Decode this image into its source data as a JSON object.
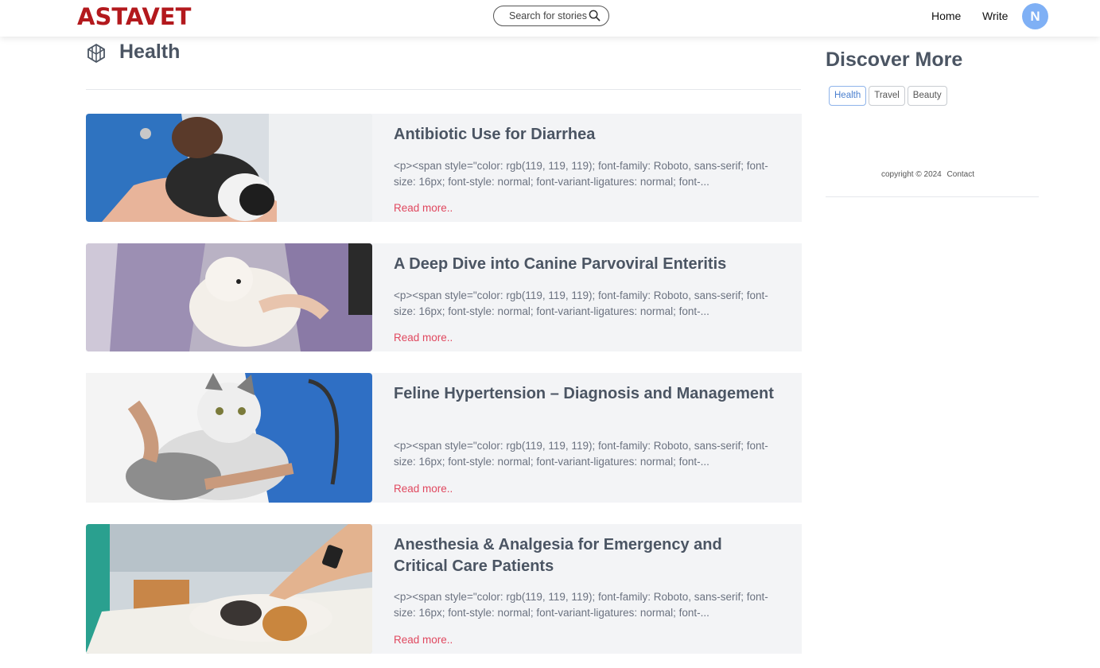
{
  "header": {
    "logo_text": "ASTAVET",
    "search_placeholder": "Search for stories",
    "nav": {
      "home": "Home",
      "write": "Write"
    },
    "avatar_initial": "N"
  },
  "category": {
    "title": "Health"
  },
  "articles": [
    {
      "title": "Antibiotic Use for Diarrhea",
      "excerpt": "<p><span style=\"color: rgb(119, 119, 119); font-family: Roboto, sans-serif; font-size: 16px; font-style: normal; font-variant-ligatures: normal; font-...",
      "read_more": "Read more.."
    },
    {
      "title": "A Deep Dive into Canine Parvoviral Enteritis",
      "excerpt": "<p><span style=\"color: rgb(119, 119, 119); font-family: Roboto, sans-serif; font-size: 16px; font-style: normal; font-variant-ligatures: normal; font-...",
      "read_more": "Read more.."
    },
    {
      "title": "Feline Hypertension – Diagnosis and Management",
      "excerpt": "<p><span style=\"color: rgb(119, 119, 119); font-family: Roboto, sans-serif; font-size: 16px; font-style: normal; font-variant-ligatures: normal; font-...",
      "read_more": "Read more.."
    },
    {
      "title": "Anesthesia & Analgesia for Emergency and Critical Care Patients",
      "excerpt": "<p><span style=\"color: rgb(119, 119, 119); font-family: Roboto, sans-serif; font-size: 16px; font-style: normal; font-variant-ligatures: normal; font-...",
      "read_more": "Read more.."
    }
  ],
  "sidebar": {
    "title": "Discover More",
    "tags": [
      "Health",
      "Travel",
      "Beauty"
    ],
    "copyright": "copyright © 2024",
    "contact": "Contact"
  },
  "colors": {
    "brand": "#b3191d",
    "read_more": "#e0485f",
    "card_bg": "#f3f4f6",
    "avatar": "#7fb0f5",
    "active_tag": "#4a7fcf"
  }
}
